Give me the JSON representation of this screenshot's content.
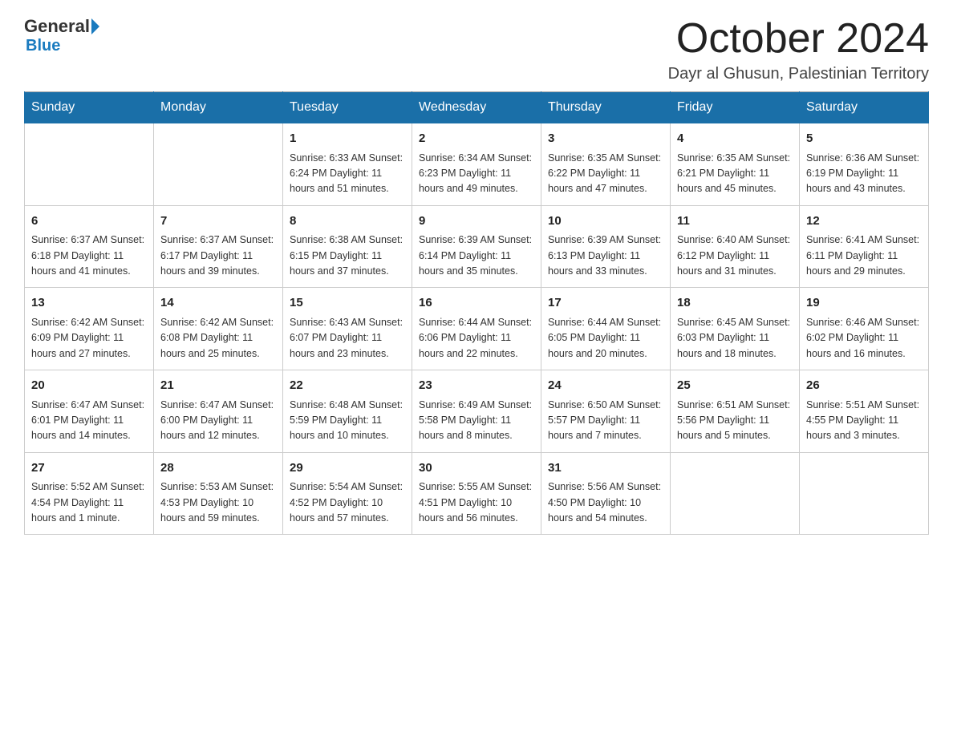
{
  "header": {
    "logo_general": "General",
    "logo_blue": "Blue",
    "month_year": "October 2024",
    "location": "Dayr al Ghusun, Palestinian Territory"
  },
  "weekdays": [
    "Sunday",
    "Monday",
    "Tuesday",
    "Wednesday",
    "Thursday",
    "Friday",
    "Saturday"
  ],
  "weeks": [
    [
      {
        "day": "",
        "info": ""
      },
      {
        "day": "",
        "info": ""
      },
      {
        "day": "1",
        "info": "Sunrise: 6:33 AM\nSunset: 6:24 PM\nDaylight: 11 hours\nand 51 minutes."
      },
      {
        "day": "2",
        "info": "Sunrise: 6:34 AM\nSunset: 6:23 PM\nDaylight: 11 hours\nand 49 minutes."
      },
      {
        "day": "3",
        "info": "Sunrise: 6:35 AM\nSunset: 6:22 PM\nDaylight: 11 hours\nand 47 minutes."
      },
      {
        "day": "4",
        "info": "Sunrise: 6:35 AM\nSunset: 6:21 PM\nDaylight: 11 hours\nand 45 minutes."
      },
      {
        "day": "5",
        "info": "Sunrise: 6:36 AM\nSunset: 6:19 PM\nDaylight: 11 hours\nand 43 minutes."
      }
    ],
    [
      {
        "day": "6",
        "info": "Sunrise: 6:37 AM\nSunset: 6:18 PM\nDaylight: 11 hours\nand 41 minutes."
      },
      {
        "day": "7",
        "info": "Sunrise: 6:37 AM\nSunset: 6:17 PM\nDaylight: 11 hours\nand 39 minutes."
      },
      {
        "day": "8",
        "info": "Sunrise: 6:38 AM\nSunset: 6:15 PM\nDaylight: 11 hours\nand 37 minutes."
      },
      {
        "day": "9",
        "info": "Sunrise: 6:39 AM\nSunset: 6:14 PM\nDaylight: 11 hours\nand 35 minutes."
      },
      {
        "day": "10",
        "info": "Sunrise: 6:39 AM\nSunset: 6:13 PM\nDaylight: 11 hours\nand 33 minutes."
      },
      {
        "day": "11",
        "info": "Sunrise: 6:40 AM\nSunset: 6:12 PM\nDaylight: 11 hours\nand 31 minutes."
      },
      {
        "day": "12",
        "info": "Sunrise: 6:41 AM\nSunset: 6:11 PM\nDaylight: 11 hours\nand 29 minutes."
      }
    ],
    [
      {
        "day": "13",
        "info": "Sunrise: 6:42 AM\nSunset: 6:09 PM\nDaylight: 11 hours\nand 27 minutes."
      },
      {
        "day": "14",
        "info": "Sunrise: 6:42 AM\nSunset: 6:08 PM\nDaylight: 11 hours\nand 25 minutes."
      },
      {
        "day": "15",
        "info": "Sunrise: 6:43 AM\nSunset: 6:07 PM\nDaylight: 11 hours\nand 23 minutes."
      },
      {
        "day": "16",
        "info": "Sunrise: 6:44 AM\nSunset: 6:06 PM\nDaylight: 11 hours\nand 22 minutes."
      },
      {
        "day": "17",
        "info": "Sunrise: 6:44 AM\nSunset: 6:05 PM\nDaylight: 11 hours\nand 20 minutes."
      },
      {
        "day": "18",
        "info": "Sunrise: 6:45 AM\nSunset: 6:03 PM\nDaylight: 11 hours\nand 18 minutes."
      },
      {
        "day": "19",
        "info": "Sunrise: 6:46 AM\nSunset: 6:02 PM\nDaylight: 11 hours\nand 16 minutes."
      }
    ],
    [
      {
        "day": "20",
        "info": "Sunrise: 6:47 AM\nSunset: 6:01 PM\nDaylight: 11 hours\nand 14 minutes."
      },
      {
        "day": "21",
        "info": "Sunrise: 6:47 AM\nSunset: 6:00 PM\nDaylight: 11 hours\nand 12 minutes."
      },
      {
        "day": "22",
        "info": "Sunrise: 6:48 AM\nSunset: 5:59 PM\nDaylight: 11 hours\nand 10 minutes."
      },
      {
        "day": "23",
        "info": "Sunrise: 6:49 AM\nSunset: 5:58 PM\nDaylight: 11 hours\nand 8 minutes."
      },
      {
        "day": "24",
        "info": "Sunrise: 6:50 AM\nSunset: 5:57 PM\nDaylight: 11 hours\nand 7 minutes."
      },
      {
        "day": "25",
        "info": "Sunrise: 6:51 AM\nSunset: 5:56 PM\nDaylight: 11 hours\nand 5 minutes."
      },
      {
        "day": "26",
        "info": "Sunrise: 5:51 AM\nSunset: 4:55 PM\nDaylight: 11 hours\nand 3 minutes."
      }
    ],
    [
      {
        "day": "27",
        "info": "Sunrise: 5:52 AM\nSunset: 4:54 PM\nDaylight: 11 hours\nand 1 minute."
      },
      {
        "day": "28",
        "info": "Sunrise: 5:53 AM\nSunset: 4:53 PM\nDaylight: 10 hours\nand 59 minutes."
      },
      {
        "day": "29",
        "info": "Sunrise: 5:54 AM\nSunset: 4:52 PM\nDaylight: 10 hours\nand 57 minutes."
      },
      {
        "day": "30",
        "info": "Sunrise: 5:55 AM\nSunset: 4:51 PM\nDaylight: 10 hours\nand 56 minutes."
      },
      {
        "day": "31",
        "info": "Sunrise: 5:56 AM\nSunset: 4:50 PM\nDaylight: 10 hours\nand 54 minutes."
      },
      {
        "day": "",
        "info": ""
      },
      {
        "day": "",
        "info": ""
      }
    ]
  ]
}
